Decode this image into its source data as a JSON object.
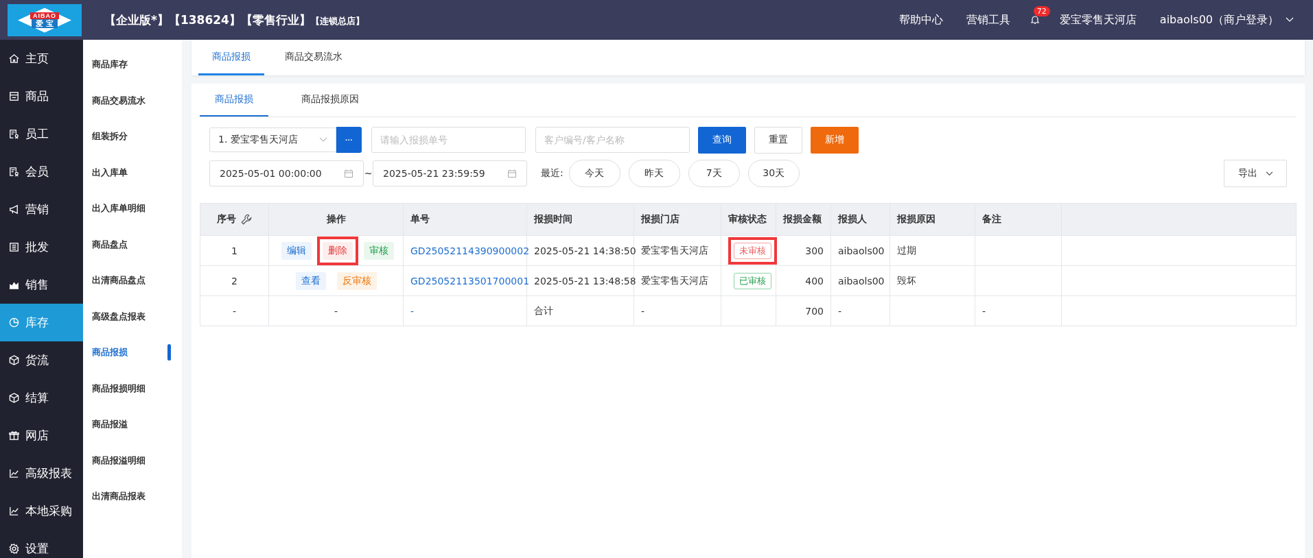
{
  "header": {
    "logo_top": "AIBAO",
    "logo_bottom": "爱 宝",
    "title_parts": [
      "【企业版*】【138624】【零售行业】"
    ],
    "title_small": "【连锁总店】",
    "links": [
      "帮助中心",
      "营销工具"
    ],
    "notifications": "72",
    "store": "爱宝零售天河店",
    "user": "aibaols00（商户登录）"
  },
  "nav": [
    {
      "label": "主页",
      "selected": false
    },
    {
      "label": "商品",
      "selected": false
    },
    {
      "label": "员工",
      "selected": false
    },
    {
      "label": "会员",
      "selected": false
    },
    {
      "label": "营销",
      "selected": false
    },
    {
      "label": "批发",
      "selected": false
    },
    {
      "label": "销售",
      "selected": false
    },
    {
      "label": "库存",
      "selected": true
    },
    {
      "label": "货流",
      "selected": false
    },
    {
      "label": "结算",
      "selected": false
    },
    {
      "label": "网店",
      "selected": false
    },
    {
      "label": "高级报表",
      "selected": false
    },
    {
      "label": "本地采购",
      "selected": false
    },
    {
      "label": "设置",
      "selected": false
    }
  ],
  "subnav": [
    {
      "label": "商品库存",
      "selected": false
    },
    {
      "label": "商品交易流水",
      "selected": false
    },
    {
      "label": "组装拆分",
      "selected": false
    },
    {
      "label": "出入库单",
      "selected": false
    },
    {
      "label": "出入库单明细",
      "selected": false
    },
    {
      "label": "商品盘点",
      "selected": false
    },
    {
      "label": "出清商品盘点",
      "selected": false
    },
    {
      "label": "高级盘点报表",
      "selected": false
    },
    {
      "label": "商品报损",
      "selected": true
    },
    {
      "label": "商品报损明细",
      "selected": false
    },
    {
      "label": "商品报溢",
      "selected": false
    },
    {
      "label": "商品报溢明细",
      "selected": false
    },
    {
      "label": "出清商品报表",
      "selected": false
    }
  ],
  "page_tabs": [
    {
      "label": "商品报损",
      "selected": true
    },
    {
      "label": "商品交易流水",
      "selected": false
    }
  ],
  "inner_tabs": [
    {
      "label": "商品报损",
      "selected": true
    },
    {
      "label": "商品报损原因",
      "selected": false
    }
  ],
  "filters": {
    "store_select": "1. 爱宝零售天河店",
    "more_button": "···",
    "order_placeholder": "请输入报损单号",
    "customer_placeholder": "客户编号/客户名称",
    "query": "查询",
    "reset": "重置",
    "add": "新增",
    "date_from": "2025-05-01 00:00:00",
    "date_sep": "~",
    "date_to": "2025-05-21 23:59:59",
    "recent_label": "最近:",
    "quick": [
      "今天",
      "昨天",
      "7天",
      "30天"
    ],
    "export": "导出"
  },
  "table": {
    "columns": [
      "序号",
      "操作",
      "单号",
      "报损时间",
      "报损门店",
      "审核状态",
      "报损金额",
      "报损人",
      "报损原因",
      "备注"
    ],
    "rows": [
      {
        "index": "1",
        "actions": [
          {
            "label": "编辑",
            "kind": "edit",
            "highlighted": false
          },
          {
            "label": "删除",
            "kind": "delete",
            "highlighted": true
          },
          {
            "label": "审核",
            "kind": "approve",
            "highlighted": false
          }
        ],
        "order": "GD25052114390900002",
        "time": "2025-05-21 14:38:50",
        "store": "爱宝零售天河店",
        "status": {
          "label": "未审核",
          "kind": "pending",
          "highlighted": true
        },
        "amount": "300",
        "person": "aibaols00",
        "reason": "过期"
      },
      {
        "index": "2",
        "actions": [
          {
            "label": "查看",
            "kind": "edit",
            "highlighted": false
          },
          {
            "label": "反审核",
            "kind": "unapprove",
            "highlighted": false
          }
        ],
        "order": "GD25052113501700001",
        "time": "2025-05-21 13:48:58",
        "store": "爱宝零售天河店",
        "status": {
          "label": "已审核",
          "kind": "approved",
          "highlighted": false
        },
        "amount": "400",
        "person": "aibaols00",
        "reason": "毁坏"
      }
    ],
    "total": {
      "index": "-",
      "actions": "-",
      "order": "-",
      "time": "合计",
      "store": "-",
      "amount": "700",
      "person": "-",
      "note": "-"
    }
  }
}
